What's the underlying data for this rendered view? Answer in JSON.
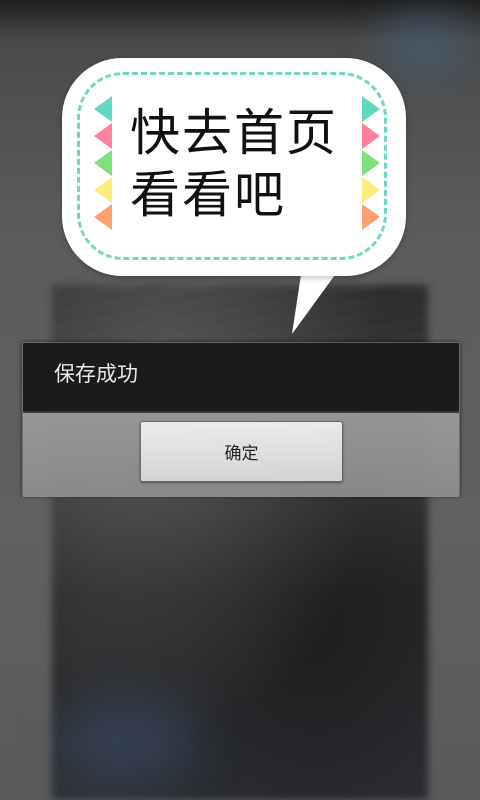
{
  "bubble": {
    "line1": "快去首页",
    "line2": "看看吧",
    "dash_color": "#6fd6c4",
    "triangle_colors": [
      "#5fd8bd",
      "#ff7f9c",
      "#7ee07e",
      "#fdec7a",
      "#ff9f6f"
    ]
  },
  "dialog": {
    "title": "保存成功",
    "confirm_label": "确定"
  }
}
